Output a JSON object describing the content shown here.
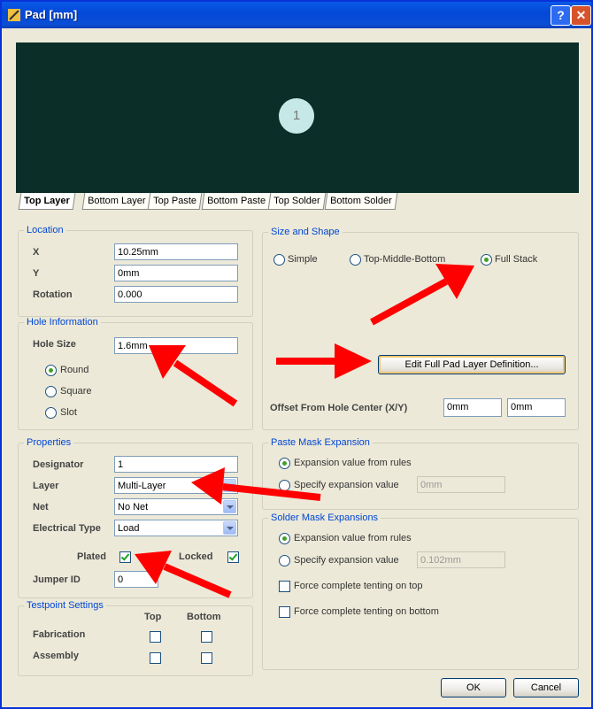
{
  "window": {
    "title": "Pad [mm]",
    "help_label": "?",
    "close_label": "✕"
  },
  "preview": {
    "pad_label": "1"
  },
  "tabs": [
    "Top Layer",
    "Bottom Layer",
    "Top Paste",
    "Bottom Paste",
    "Top Solder",
    "Bottom Solder"
  ],
  "location": {
    "title": "Location",
    "x_label": "X",
    "x_value": "10.25mm",
    "y_label": "Y",
    "y_value": "0mm",
    "rotation_label": "Rotation",
    "rotation_value": "0.000"
  },
  "hole": {
    "title": "Hole Information",
    "size_label": "Hole Size",
    "size_value": "1.6mm",
    "round_label": "Round",
    "square_label": "Square",
    "slot_label": "Slot",
    "selected": "Round"
  },
  "size_shape": {
    "title": "Size and Shape",
    "simple_label": "Simple",
    "tmb_label": "Top-Middle-Bottom",
    "full_label": "Full Stack",
    "selected": "Full Stack",
    "edit_button": "Edit Full Pad Layer Definition...",
    "offset_label": "Offset From Hole Center (X/Y)",
    "offset_x": "0mm",
    "offset_y": "0mm"
  },
  "properties": {
    "title": "Properties",
    "designator_label": "Designator",
    "designator_value": "1",
    "layer_label": "Layer",
    "layer_value": "Multi-Layer",
    "net_label": "Net",
    "net_value": "No Net",
    "etype_label": "Electrical Type",
    "etype_value": "Load",
    "plated_label": "Plated",
    "plated": true,
    "locked_label": "Locked",
    "locked": true,
    "jumper_label": "Jumper ID",
    "jumper_value": "0"
  },
  "testpoint": {
    "title": "Testpoint Settings",
    "top_label": "Top",
    "bottom_label": "Bottom",
    "fabrication_label": "Fabrication",
    "assembly_label": "Assembly"
  },
  "paste": {
    "title": "Paste Mask Expansion",
    "rules_label": "Expansion value from rules",
    "specify_label": "Specify expansion value",
    "specify_value": "0mm",
    "selected": "rules"
  },
  "solder": {
    "title": "Solder Mask Expansions",
    "rules_label": "Expansion value from rules",
    "specify_label": "Specify expansion value",
    "specify_value": "0.102mm",
    "selected": "rules",
    "tent_top_label": "Force complete tenting on top",
    "tent_bottom_label": "Force complete tenting on bottom"
  },
  "footer": {
    "ok_label": "OK",
    "cancel_label": "Cancel"
  },
  "colors": {
    "title_bar": "#0349d9",
    "preview_bg": "#0b2e28",
    "group_title": "#0046d5",
    "annotation_arrow": "#ff0000"
  }
}
